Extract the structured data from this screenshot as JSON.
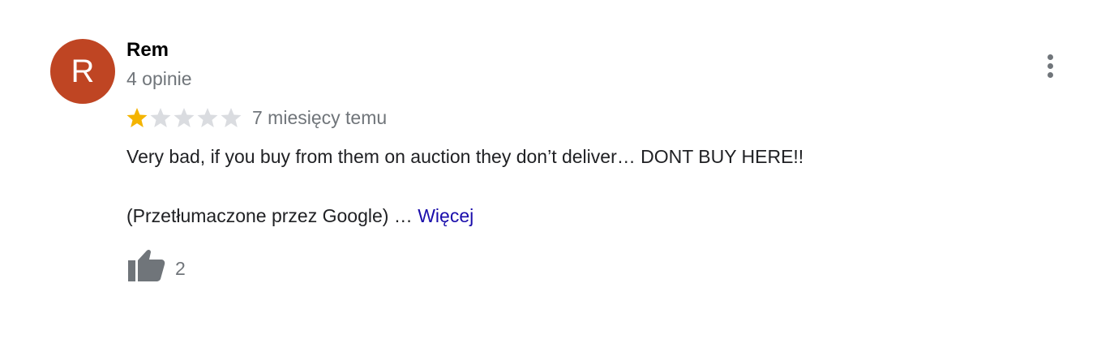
{
  "review": {
    "avatar_letter": "R",
    "avatar_color": "#bf4523",
    "author": "Rem",
    "review_count": "4 opinie",
    "rating": 1,
    "rating_max": 5,
    "time": "7 miesięcy temu",
    "text": "Very bad, if you buy from them on auction they don’t deliver… DONT BUY HERE!!",
    "translated_label": "(Przetłumaczone przez Google) …",
    "more_label": "Więcej",
    "likes": "2"
  },
  "icons": {
    "menu": "more-vertical-icon",
    "like": "thumbs-up-icon",
    "star": "star-icon"
  },
  "colors": {
    "star_filled": "#f4b400",
    "star_empty": "#dadce0",
    "link": "#1a0dab",
    "secondary_text": "#70757a"
  }
}
